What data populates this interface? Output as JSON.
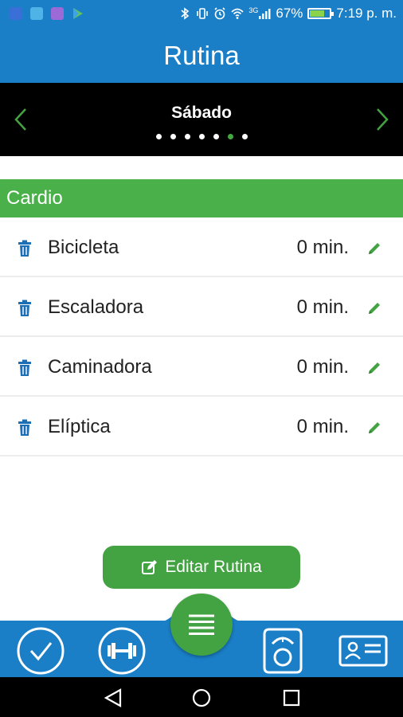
{
  "status_bar": {
    "battery_percent_text": "67%",
    "battery_level": 0.67,
    "time": "7:19 p. m.",
    "network_label": "3G",
    "icons": [
      "app-icon",
      "app-icon",
      "app-icon",
      "play-store-icon",
      "bluetooth-icon",
      "vibrate-icon",
      "alarm-icon",
      "wifi-icon",
      "signal-icon",
      "battery-icon"
    ]
  },
  "app_bar": {
    "title": "Rutina"
  },
  "day_nav": {
    "day": "Sábado",
    "page_count": 7,
    "active_index": 5,
    "prev_icon": "chevron-left-icon",
    "next_icon": "chevron-right-icon"
  },
  "section": {
    "title": "Cardio"
  },
  "exercises": [
    {
      "name": "Bicicleta",
      "duration": "0 min."
    },
    {
      "name": "Escaladora",
      "duration": "0 min."
    },
    {
      "name": "Caminadora",
      "duration": "0 min."
    },
    {
      "name": "Elíptica",
      "duration": "0 min."
    }
  ],
  "edit_button": {
    "label": "Editar Rutina",
    "icon": "edit-icon"
  },
  "bottom_nav": {
    "tabs": [
      "check-icon",
      "dumbbell-icon",
      "menu-icon",
      "scale-icon",
      "id-card-icon"
    ]
  },
  "colors": {
    "primary_blue": "#1a7fc7",
    "accent_green": "#43a342",
    "section_green": "#4ab04a",
    "icon_blue": "#1d6fb5"
  }
}
